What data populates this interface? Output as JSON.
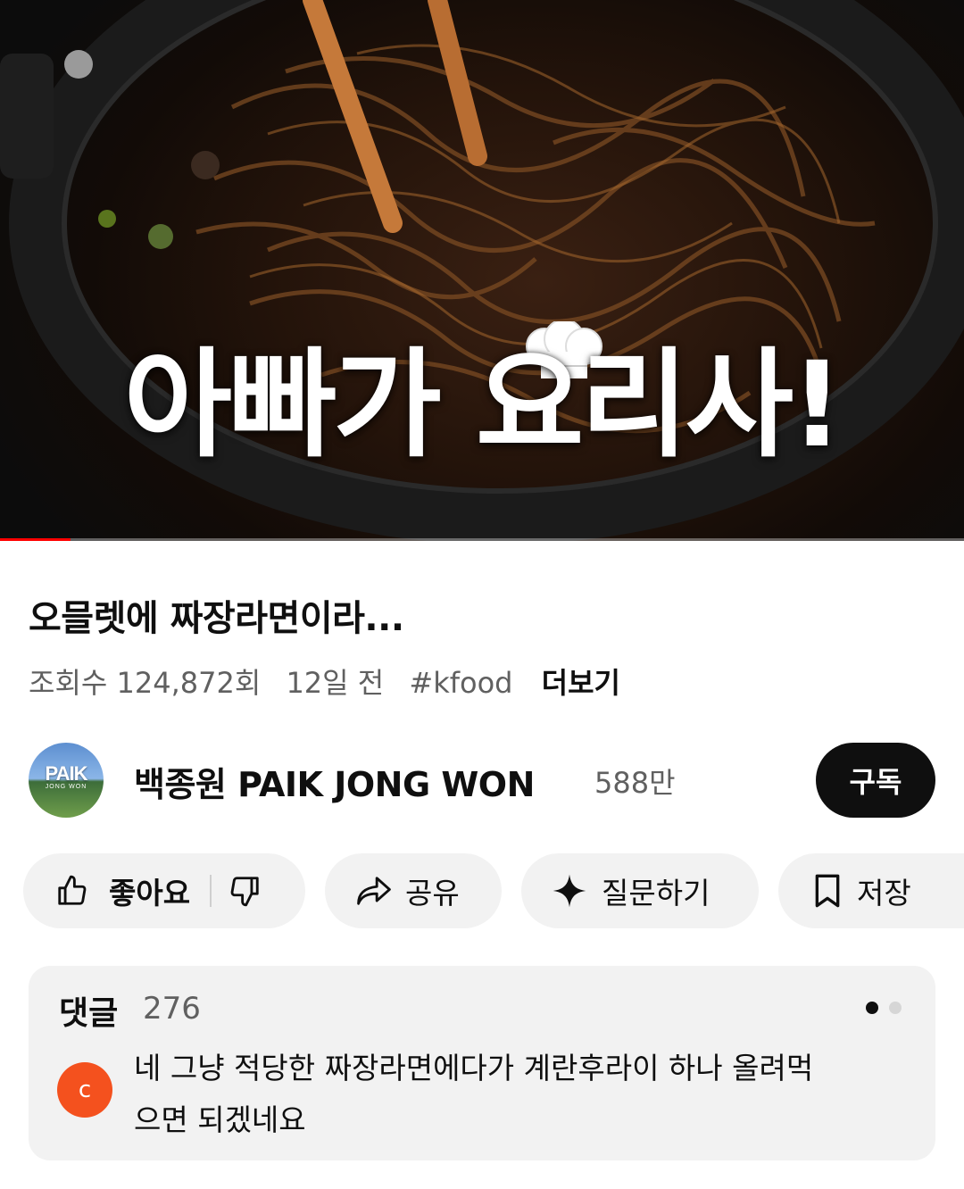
{
  "player": {
    "overlay_text": "아빠가 요리사!",
    "progress_fraction": 0.073,
    "colors": {
      "progress": "#ff0000"
    }
  },
  "video": {
    "title": "오믈렛에 짜장라면이라...",
    "views": "조회수 124,872회",
    "age": "12일 전",
    "hashtag": "#kfood",
    "more_label": "더보기"
  },
  "channel": {
    "avatar_text": "PAIK",
    "avatar_subtext": "JONG WON",
    "name": "백종원 PAIK JONG WON",
    "subscribers": "588만",
    "subscribe_label": "구독"
  },
  "actions": {
    "like_label": "좋아요",
    "share_label": "공유",
    "ask_label": "질문하기",
    "save_label": "저장",
    "icons": [
      "thumbs-up-icon",
      "thumbs-down-icon",
      "share-arrow-icon",
      "sparkle-icon",
      "bookmark-icon"
    ]
  },
  "comments": {
    "title": "댓글",
    "count": "276",
    "top_comment": {
      "avatar_initial": "c",
      "text": "네 그냥 적당한 짜장라면에다가 계란후라이 하나 올려먹으면 되겠네요",
      "avatar_color": "#f4511e"
    }
  }
}
